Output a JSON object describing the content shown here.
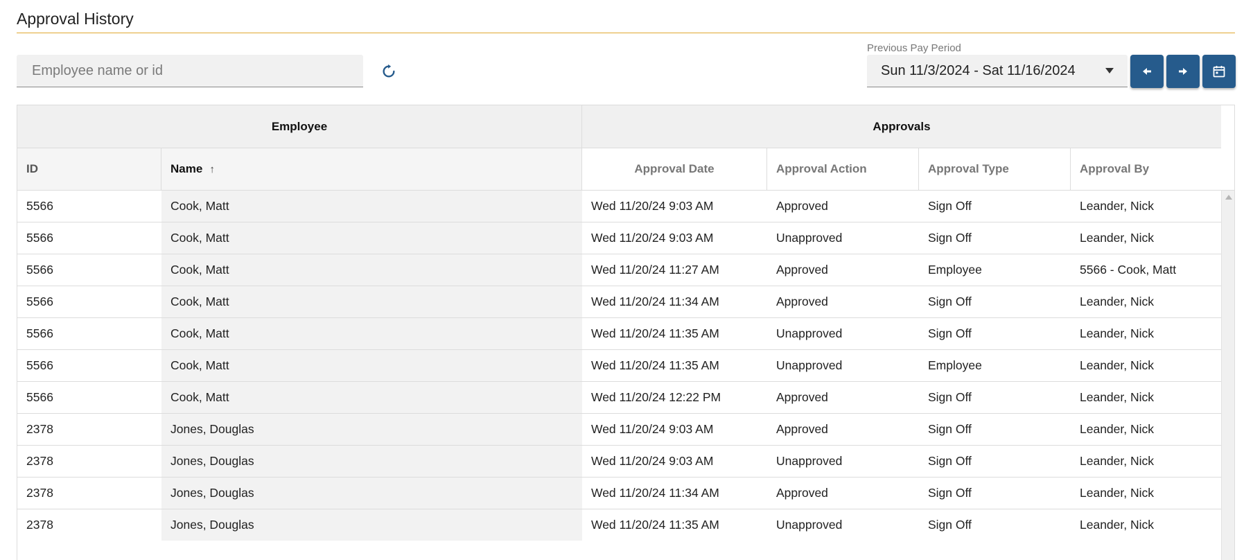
{
  "page": {
    "title": "Approval History"
  },
  "search": {
    "placeholder": "Employee name or id",
    "value": ""
  },
  "icons": {
    "refresh": "refresh-icon",
    "prev": "arrow-left-icon",
    "next": "arrow-right-icon",
    "calendar": "calendar-icon",
    "sort": "sort-ascending-icon"
  },
  "colors": {
    "accent": "#e0a82e",
    "button": "#265b8c",
    "refresh": "#265b8c"
  },
  "period": {
    "label": "Previous Pay Period",
    "selected": "Sun 11/3/2024 - Sat 11/16/2024"
  },
  "grid": {
    "groups": {
      "employee": "Employee",
      "approvals": "Approvals"
    },
    "columns": {
      "id": "ID",
      "name": "Name",
      "sort_indicator": "↑",
      "approval_date": "Approval Date",
      "approval_action": "Approval Action",
      "approval_type": "Approval Type",
      "approval_by": "Approval By"
    },
    "rows": [
      {
        "id": "5566",
        "name": "Cook, Matt",
        "date": "Wed 11/20/24 9:03 AM",
        "action": "Approved",
        "type": "Sign Off",
        "by": "Leander, Nick"
      },
      {
        "id": "5566",
        "name": "Cook, Matt",
        "date": "Wed 11/20/24 9:03 AM",
        "action": "Unapproved",
        "type": "Sign Off",
        "by": "Leander, Nick"
      },
      {
        "id": "5566",
        "name": "Cook, Matt",
        "date": "Wed 11/20/24 11:27 AM",
        "action": "Approved",
        "type": "Employee",
        "by": "5566 - Cook, Matt"
      },
      {
        "id": "5566",
        "name": "Cook, Matt",
        "date": "Wed 11/20/24 11:34 AM",
        "action": "Approved",
        "type": "Sign Off",
        "by": "Leander, Nick"
      },
      {
        "id": "5566",
        "name": "Cook, Matt",
        "date": "Wed 11/20/24 11:35 AM",
        "action": "Unapproved",
        "type": "Sign Off",
        "by": "Leander, Nick"
      },
      {
        "id": "5566",
        "name": "Cook, Matt",
        "date": "Wed 11/20/24 11:35 AM",
        "action": "Unapproved",
        "type": "Employee",
        "by": "Leander, Nick"
      },
      {
        "id": "5566",
        "name": "Cook, Matt",
        "date": "Wed 11/20/24 12:22 PM",
        "action": "Approved",
        "type": "Sign Off",
        "by": "Leander, Nick"
      },
      {
        "id": "2378",
        "name": "Jones, Douglas",
        "date": "Wed 11/20/24 9:03 AM",
        "action": "Approved",
        "type": "Sign Off",
        "by": "Leander, Nick"
      },
      {
        "id": "2378",
        "name": "Jones, Douglas",
        "date": "Wed 11/20/24 9:03 AM",
        "action": "Unapproved",
        "type": "Sign Off",
        "by": "Leander, Nick"
      },
      {
        "id": "2378",
        "name": "Jones, Douglas",
        "date": "Wed 11/20/24 11:34 AM",
        "action": "Approved",
        "type": "Sign Off",
        "by": "Leander, Nick"
      },
      {
        "id": "2378",
        "name": "Jones, Douglas",
        "date": "Wed 11/20/24 11:35 AM",
        "action": "Unapproved",
        "type": "Sign Off",
        "by": "Leander, Nick"
      }
    ]
  }
}
